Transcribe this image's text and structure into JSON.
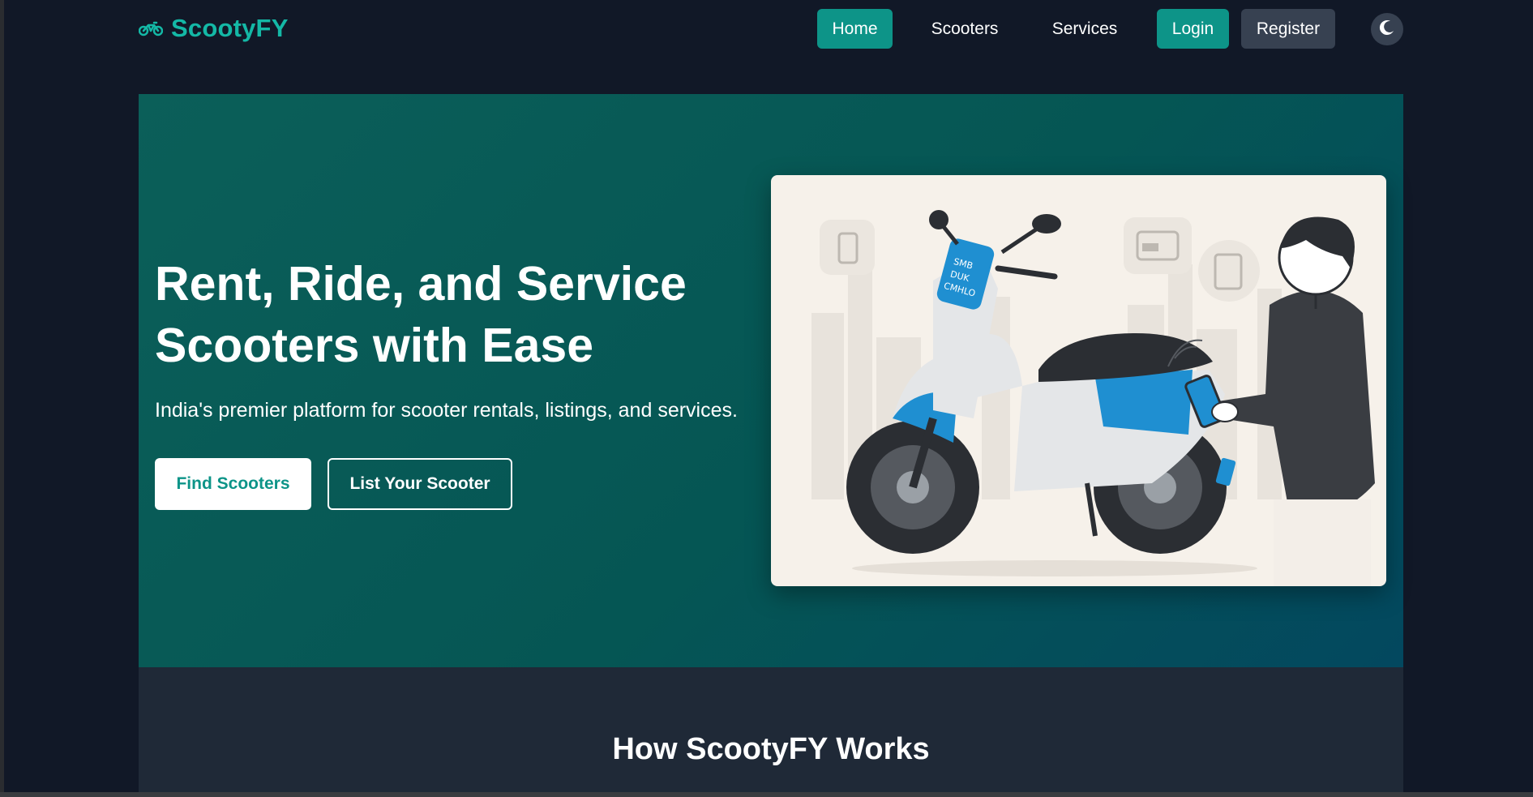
{
  "brand": {
    "name": "ScootyFY",
    "icon": "motorcycle-icon",
    "color": "#14b8a6"
  },
  "nav": {
    "home": "Home",
    "scooters": "Scooters",
    "services": "Services",
    "login": "Login",
    "register": "Register",
    "theme_icon": "moon-icon"
  },
  "hero": {
    "title_line1": "Rent, Ride, and Service",
    "title_line2": "Scooters with Ease",
    "subtitle": "India's premier platform for scooter rentals, listings, and services.",
    "primary_button": "Find Scooters",
    "secondary_button": "List Your Scooter",
    "illustration": "scooter-rental-illustration",
    "scooter_screen_text": [
      "SMB",
      "DUK",
      "CMHLO"
    ]
  },
  "how": {
    "title": "How ScootyFY Works"
  },
  "colors": {
    "accent": "#0d9488",
    "background": "#111827",
    "section": "#1f2937",
    "register_button": "#374151",
    "hero_gradient": [
      "#0b5f59",
      "#03485f"
    ]
  }
}
